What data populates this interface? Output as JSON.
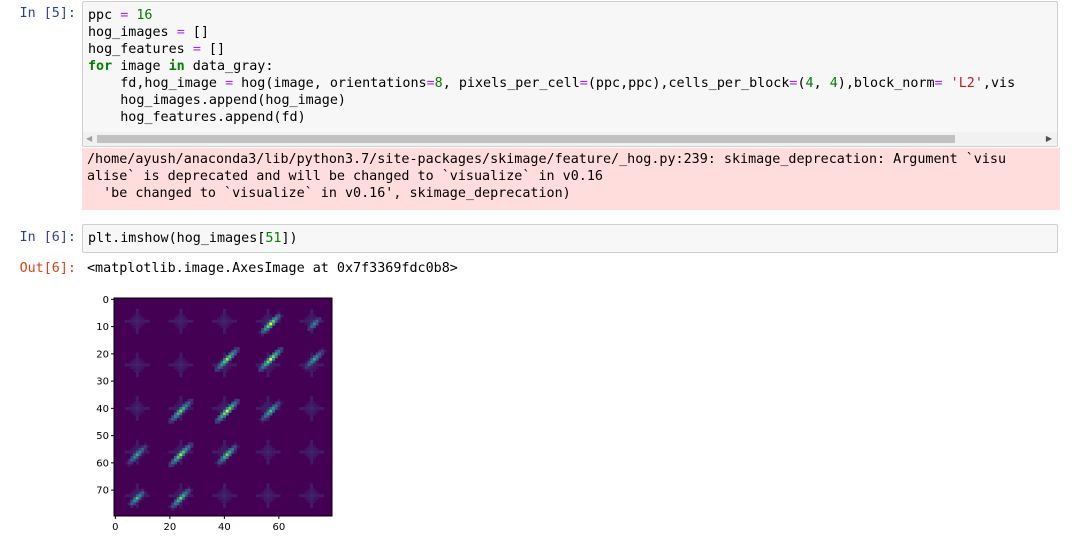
{
  "cells": [
    {
      "prompt": "In [5]:",
      "code": [
        [
          [
            "ppc ",
            ""
          ],
          [
            "=",
            "op"
          ],
          [
            " ",
            ""
          ],
          [
            "16",
            "num"
          ]
        ],
        [
          [
            "hog_images ",
            ""
          ],
          [
            "=",
            "op"
          ],
          [
            " []",
            ""
          ]
        ],
        [
          [
            "hog_features ",
            ""
          ],
          [
            "=",
            "op"
          ],
          [
            " []",
            ""
          ]
        ],
        [
          [
            "for",
            "kw"
          ],
          [
            " image ",
            ""
          ],
          [
            "in",
            "kw"
          ],
          [
            " data_gray:",
            ""
          ]
        ],
        [
          [
            "    fd,hog_image ",
            ""
          ],
          [
            "=",
            "op"
          ],
          [
            " hog(image, orientations",
            ""
          ],
          [
            "=",
            "op"
          ],
          [
            "8",
            "num"
          ],
          [
            ", pixels_per_cell",
            ""
          ],
          [
            "=",
            "op"
          ],
          [
            "(ppc,ppc),cells_per_block",
            ""
          ],
          [
            "=",
            "op"
          ],
          [
            "(",
            ""
          ],
          [
            "4",
            "num"
          ],
          [
            ", ",
            ""
          ],
          [
            "4",
            "num"
          ],
          [
            "),block_norm",
            ""
          ],
          [
            "=",
            "op"
          ],
          [
            " ",
            ""
          ],
          [
            "'L2'",
            "str"
          ],
          [
            ",vis",
            ""
          ]
        ],
        [
          [
            "    hog_images.append(hog_image)",
            ""
          ]
        ],
        [
          [
            "    hog_features.append(fd)",
            ""
          ]
        ]
      ],
      "stderr": [
        "/home/ayush/anaconda3/lib/python3.7/site-packages/skimage/feature/_hog.py:239: skimage_deprecation: Argument `visu",
        "alise` is deprecated and will be changed to `visualize` in v0.16",
        "  'be changed to `visualize` in v0.16', skimage_deprecation)"
      ]
    },
    {
      "prompt": "In [6]:",
      "code": [
        [
          [
            "plt.imshow(hog_images[",
            ""
          ],
          [
            "51",
            "num"
          ],
          [
            "])",
            ""
          ]
        ]
      ],
      "out_prompt": "Out[6]:",
      "output": "<matplotlib.image.AxesImage at 0x7f3369fdc0b8>"
    }
  ],
  "plot": {
    "y_ticks": [
      "0",
      "10",
      "20",
      "30",
      "40",
      "50",
      "60",
      "70"
    ],
    "x_ticks": [
      "0",
      "20",
      "40",
      "60"
    ],
    "colormap": [
      "#440154",
      "#3b528b",
      "#21918c",
      "#5ec962",
      "#fde725"
    ]
  }
}
